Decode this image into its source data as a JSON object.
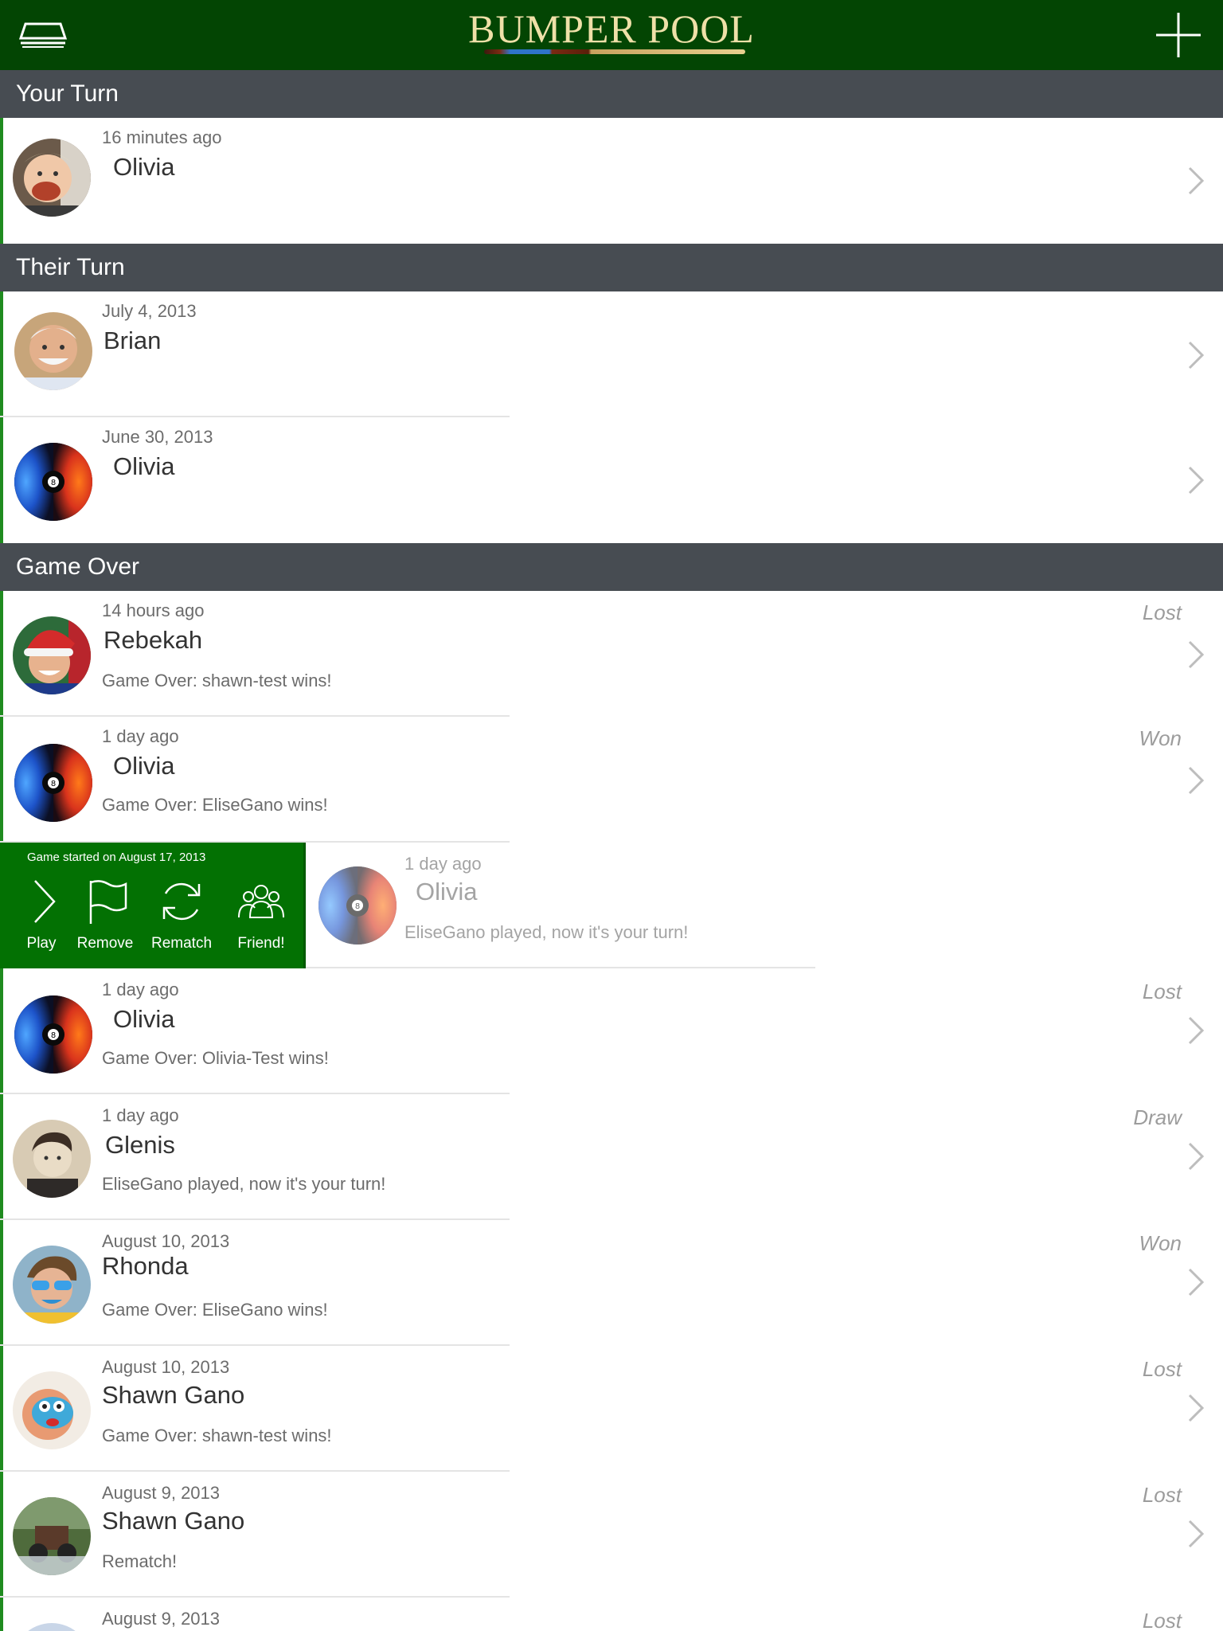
{
  "app": {
    "title": "BUMPER POOL"
  },
  "toolbar": {
    "menu_icon": "table-icon",
    "add_icon": "plus-icon"
  },
  "sections": {
    "your_turn": "Your Turn",
    "their_turn": "Their Turn",
    "game_over": "Game Over"
  },
  "your_turn_games": [
    {
      "time": "16 minutes ago",
      "name": "Olivia",
      "avatar": "toddler-photo"
    }
  ],
  "their_turn_games": [
    {
      "time": "July 4, 2013",
      "name": "Brian",
      "avatar": "man-photo"
    },
    {
      "time": "June 30, 2013",
      "name": "Olivia",
      "avatar": "eight-ball-splash"
    }
  ],
  "game_over_games": [
    {
      "time": "14 hours ago",
      "name": "Rebekah",
      "status": "Game Over: shawn-test wins!",
      "result": "Lost"
    },
    {
      "time": "1 day ago",
      "name": "Olivia",
      "status": "Game Over: EliseGano wins!",
      "result": "Won"
    },
    {
      "time": "1 day ago",
      "name": "Olivia",
      "status": "EliseGano played, now it's your turn!",
      "result": ""
    },
    {
      "time": "1 day ago",
      "name": "Olivia",
      "status": "Game Over: Olivia-Test wins!",
      "result": "Lost"
    },
    {
      "time": "1 day ago",
      "name": "Glenis",
      "status": "EliseGano played, now it's your turn!",
      "result": "Draw"
    },
    {
      "time": "August 10, 2013",
      "name": "Rhonda",
      "status": "Game Over: EliseGano wins!",
      "result": "Won"
    },
    {
      "time": "August 10, 2013",
      "name": "Shawn Gano",
      "status": "Game Over: shawn-test wins!",
      "result": "Lost"
    },
    {
      "time": "August 9, 2013",
      "name": "Shawn Gano",
      "status": "Rematch!",
      "result": "Lost"
    },
    {
      "time": "August 9, 2013",
      "name": "",
      "status": "",
      "result": "Lost"
    }
  ],
  "action_panel": {
    "caption": "Game started on August 17, 2013",
    "play": "Play",
    "remove": "Remove",
    "rematch": "Rematch",
    "friend": "Friend!"
  },
  "colors": {
    "navbar": "#034503",
    "section_header": "#474c52",
    "accent": "#1f8b1f",
    "action_panel": "#037103",
    "title_text": "#efe0a8"
  }
}
